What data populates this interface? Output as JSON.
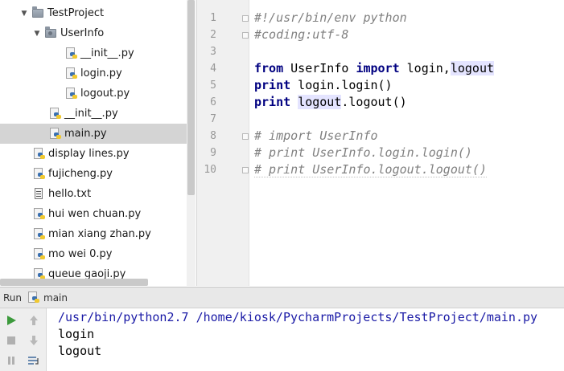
{
  "project_tree": {
    "root": "TestProject",
    "package": "UserInfo",
    "items": [
      {
        "label": "__init__.py"
      },
      {
        "label": "login.py"
      },
      {
        "label": "logout.py"
      },
      {
        "label": "__init__.py"
      },
      {
        "label": "main.py"
      },
      {
        "label": "display lines.py"
      },
      {
        "label": "fujicheng.py"
      },
      {
        "label": "hello.txt"
      },
      {
        "label": "hui wen chuan.py"
      },
      {
        "label": "mian xiang zhan.py"
      },
      {
        "label": "mo wei 0.py"
      },
      {
        "label": "queue gaoji.py"
      }
    ]
  },
  "editor": {
    "line_numbers": [
      "1",
      "2",
      "3",
      "4",
      "5",
      "6",
      "7",
      "8",
      "9",
      "10"
    ],
    "lines": {
      "l1": "#!/usr/bin/env python",
      "l2": "#coding:utf-8",
      "l4_kw1": "from",
      "l4_mod": " UserInfo ",
      "l4_kw2": "import",
      "l4_names": " login,",
      "l4_hl": "logout",
      "l5_kw": "print",
      "l5_rest": " login.login()",
      "l6_kw": "print",
      "l6_hl": "logout",
      "l6_rest": ".logout()",
      "l8": "# import UserInfo",
      "l9": "# print UserInfo.login.login()",
      "l10": "# print UserInfo.logout.logout()"
    }
  },
  "run_panel": {
    "label": "Run",
    "config_name": "main",
    "output": [
      "/usr/bin/python2.7 /home/kiosk/PycharmProjects/TestProject/main.py",
      "login",
      "logout"
    ]
  },
  "colors": {
    "keyword": "#000080",
    "comment": "#808080",
    "command": "#1a1aa6",
    "caret_line": "#fffae3",
    "selection": "#d4d4d4"
  }
}
